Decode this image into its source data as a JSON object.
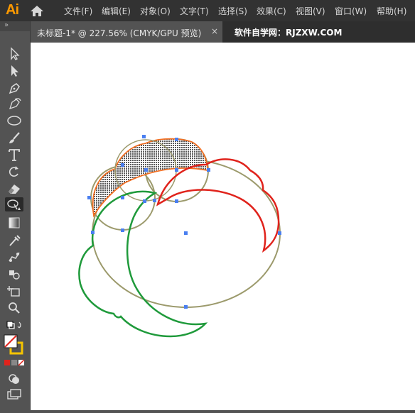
{
  "app": {
    "logo_text": "Ai"
  },
  "menu": [
    {
      "label": "文件(F)"
    },
    {
      "label": "编辑(E)"
    },
    {
      "label": "对象(O)"
    },
    {
      "label": "文字(T)"
    },
    {
      "label": "选择(S)"
    },
    {
      "label": "效果(C)"
    },
    {
      "label": "视图(V)"
    },
    {
      "label": "窗口(W)"
    },
    {
      "label": "帮助(H)"
    }
  ],
  "document_tab": {
    "title": "未标题-1* @ 227.56% (CMYK/GPU 预览)",
    "close_glyph": "×"
  },
  "site_label": "软件自学网：RJZXW.COM",
  "toolbar": {
    "collapse_glyph": "»"
  },
  "colors": {
    "menubar": "#323232",
    "accent": "#ff9a00",
    "red_path": "#e0231c",
    "green_path": "#1f9a3b",
    "olive_path": "#9c9a6c",
    "anchor": "#4a7ff0"
  }
}
